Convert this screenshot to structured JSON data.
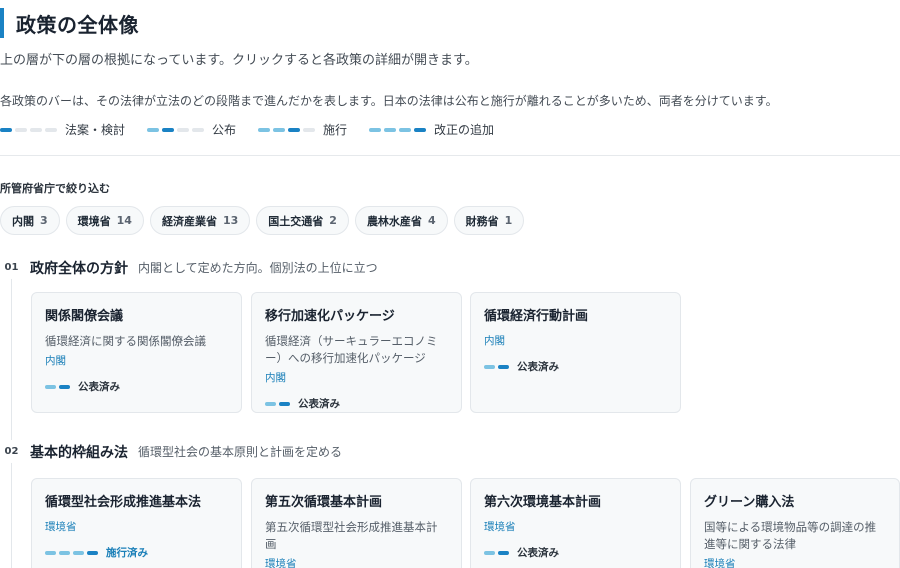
{
  "page": {
    "title": "政策の全体像",
    "intro": "上の層が下の層の根拠になっています。クリックすると各政策の詳細が開きます。",
    "description": "各政策のバーは、その法律が立法のどの段階まで進んだかを表します。日本の法律は公布と施行が離れることが多いため、両者を分けています。"
  },
  "legend": [
    {
      "label": "法案・検討",
      "stage": 1
    },
    {
      "label": "公布",
      "stage": 2
    },
    {
      "label": "施行",
      "stage": 3
    },
    {
      "label": "改正の追加",
      "stage": 4
    }
  ],
  "filter": {
    "label": "所管府省庁で絞り込む",
    "chips": [
      {
        "name": "内閣",
        "count": "3"
      },
      {
        "name": "環境省",
        "count": "14"
      },
      {
        "name": "経済産業省",
        "count": "13"
      },
      {
        "name": "国土交通省",
        "count": "2"
      },
      {
        "name": "農林水産省",
        "count": "4"
      },
      {
        "name": "財務省",
        "count": "1"
      }
    ]
  },
  "sections": [
    {
      "number": "01",
      "title": "政府全体の方針",
      "subtitle": "内閣として定めた方向。個別法の上位に立つ",
      "cards": [
        {
          "title": "関係閣僚会議",
          "description": "循環経済に関する関係閣僚会議",
          "ministry": "内閣",
          "status": "公表済み",
          "stage": 2,
          "total": 2
        },
        {
          "title": "移行加速化パッケージ",
          "description": "循環経済（サーキュラーエコノミー）への移行加速化パッケージ",
          "ministry": "内閣",
          "status": "公表済み",
          "stage": 2,
          "total": 2
        },
        {
          "title": "循環経済行動計画",
          "description": "",
          "ministry": "内閣",
          "status": "公表済み",
          "stage": 2,
          "total": 2
        }
      ]
    },
    {
      "number": "02",
      "title": "基本的枠組み法",
      "subtitle": "循環型社会の基本原則と計画を定める",
      "cards": [
        {
          "title": "循環型社会形成推進基本法",
          "description": "",
          "ministry": "環境省",
          "status": "施行済み",
          "stage": 4,
          "total": 4
        },
        {
          "title": "第五次循環基本計画",
          "description": "第五次循環型社会形成推進基本計画",
          "ministry": "環境省",
          "status": "",
          "stage": 0,
          "total": 0
        },
        {
          "title": "第六次環境基本計画",
          "description": "",
          "ministry": "環境省",
          "status": "公表済み",
          "stage": 2,
          "total": 2
        },
        {
          "title": "グリーン購入法",
          "description": "国等による環境物品等の調達の推進等に関する法律",
          "ministry": "環境省",
          "status": "",
          "stage": 0,
          "total": 0
        }
      ]
    }
  ],
  "colors": {
    "accent": "#1a82c4",
    "filled": "#7cc3e3",
    "empty": "#e3e7eb",
    "ministry": "#1a7fb8"
  }
}
